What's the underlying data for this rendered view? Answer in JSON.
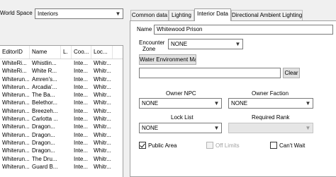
{
  "world_space": {
    "label": "World Space",
    "selected": "Interiors"
  },
  "cell_list": {
    "columns": [
      "EditorID",
      "Name",
      "L.",
      "Coo...",
      "Loc..."
    ],
    "rows": [
      [
        "WhiteRi...",
        "Whistlin...",
        "",
        "Inte...",
        "Whitr..."
      ],
      [
        "WhiteRi...",
        "White R...",
        "",
        "Inte...",
        "Whitr..."
      ],
      [
        "Whiterun...",
        "Amren's...",
        "",
        "Inte...",
        "Whitr..."
      ],
      [
        "Whiterun...",
        "Arcadia'...",
        "",
        "Inte...",
        "Whitr..."
      ],
      [
        "Whiterun...",
        "The Ba...",
        "",
        "Inte...",
        "Whitr..."
      ],
      [
        "Whiterun...",
        "Belethor...",
        "",
        "Inte...",
        "Whitr..."
      ],
      [
        "Whiterun...",
        "Breezeh...",
        "",
        "Inte...",
        "Whitr..."
      ],
      [
        "Whiterun...",
        "Carlotta ...",
        "",
        "Inte...",
        "Whitr..."
      ],
      [
        "Whiterun...",
        "Dragon...",
        "",
        "Inte...",
        "Whitr..."
      ],
      [
        "Whiterun...",
        "Dragon...",
        "",
        "Inte...",
        "Whitr..."
      ],
      [
        "Whiterun...",
        "Dragon...",
        "",
        "Inte...",
        "Whitr..."
      ],
      [
        "Whiterun...",
        "Dragon...",
        "",
        "Inte...",
        "Whitr..."
      ],
      [
        "Whiterun...",
        "The Dru...",
        "",
        "Inte...",
        "Whitr..."
      ],
      [
        "Whiterun...",
        "Guard B...",
        "",
        "Inte...",
        "Whitr..."
      ]
    ]
  },
  "tabs": [
    {
      "label": "Common data"
    },
    {
      "label": "Lighting"
    },
    {
      "label": "Interior Data"
    },
    {
      "label": "Directional Ambient Lighting"
    }
  ],
  "interior": {
    "name_label": "Name",
    "name_value": "Whitewood Prison",
    "encounter_label_1": "Encounter",
    "encounter_label_2": "Zone",
    "encounter_value": "NONE",
    "water_button": "Water Environment Ma",
    "water_value": "",
    "clear_button": "Clear",
    "owner_npc_label": "Owner NPC",
    "owner_npc_value": "NONE",
    "owner_faction_label": "Owner Faction",
    "owner_faction_value": "NONE",
    "lock_list_label": "Lock List",
    "lock_list_value": "NONE",
    "required_rank_label": "Required Rank",
    "required_rank_value": "",
    "public_area_label": "Public Area",
    "public_area_checked": true,
    "off_limits_label": "Off Limits",
    "off_limits_checked": false,
    "cant_wait_label": "Can't Wait",
    "cant_wait_checked": false
  }
}
